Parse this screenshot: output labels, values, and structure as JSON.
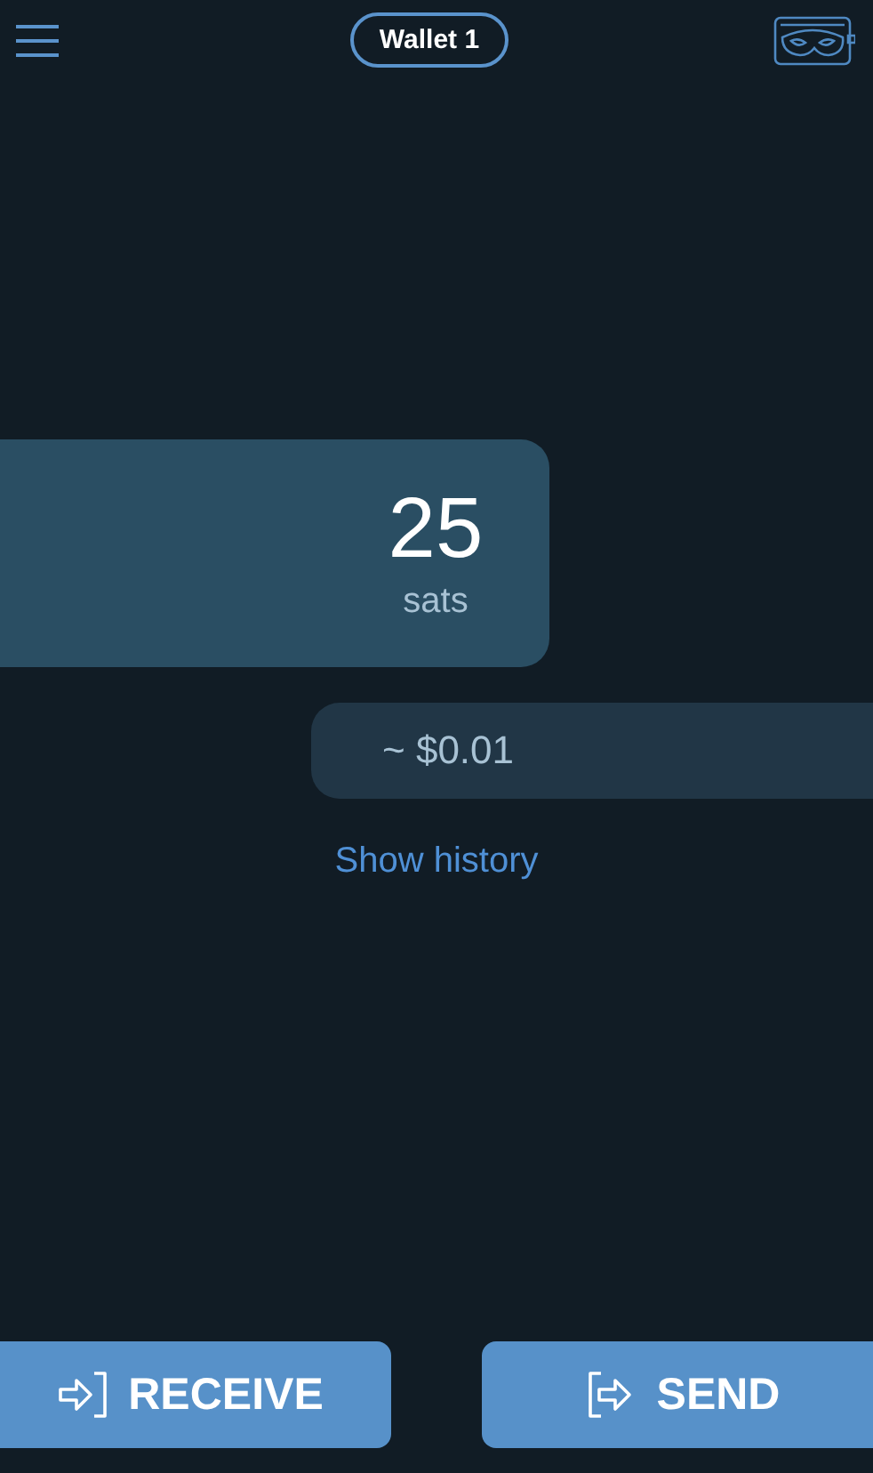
{
  "header": {
    "wallet_name": "Wallet 1"
  },
  "balance": {
    "amount": "25",
    "unit": "sats"
  },
  "fiat": {
    "value": "~ $0.01"
  },
  "history_link": "Show history",
  "actions": [
    {
      "label": "RECEIVE",
      "kind": "receive"
    },
    {
      "label": "SEND",
      "kind": "send"
    }
  ]
}
